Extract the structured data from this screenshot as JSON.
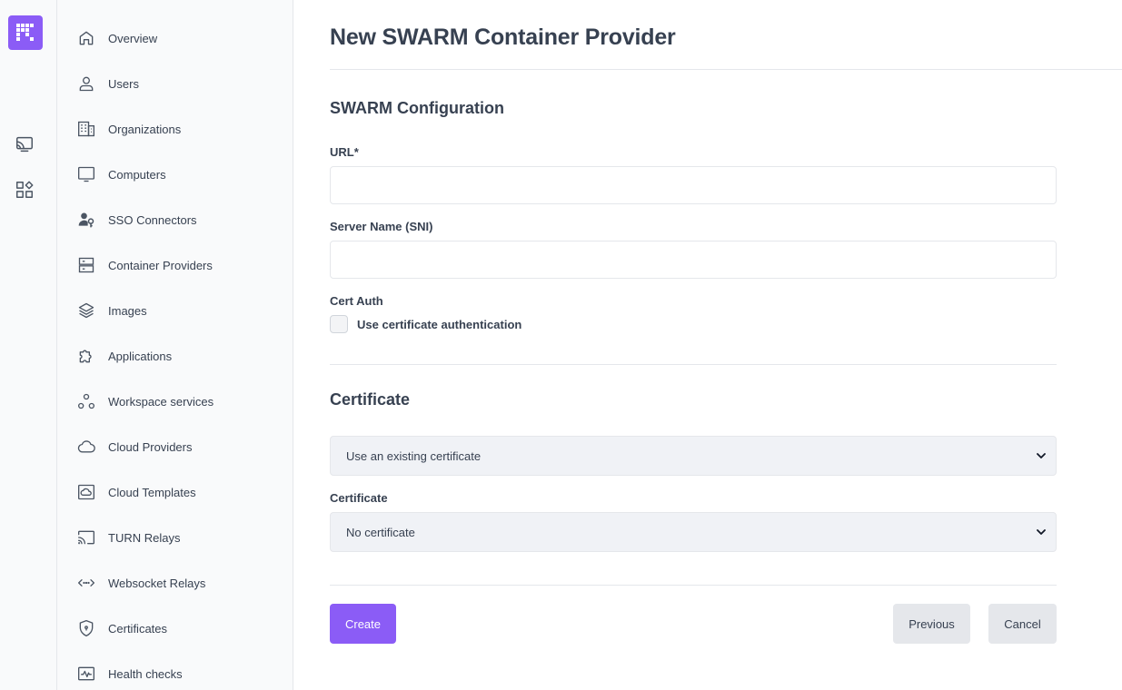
{
  "nav": {
    "items": [
      {
        "label": "Overview",
        "icon": "home-icon"
      },
      {
        "label": "Users",
        "icon": "user-icon"
      },
      {
        "label": "Organizations",
        "icon": "building-icon"
      },
      {
        "label": "Computers",
        "icon": "monitor-icon"
      },
      {
        "label": "SSO Connectors",
        "icon": "user-key-icon"
      },
      {
        "label": "Container Providers",
        "icon": "server-icon"
      },
      {
        "label": "Images",
        "icon": "layers-icon"
      },
      {
        "label": "Applications",
        "icon": "puzzle-icon"
      },
      {
        "label": "Workspace services",
        "icon": "nodes-icon"
      },
      {
        "label": "Cloud Providers",
        "icon": "cloud-icon"
      },
      {
        "label": "Cloud Templates",
        "icon": "cloud-template-icon"
      },
      {
        "label": "TURN Relays",
        "icon": "cast-icon"
      },
      {
        "label": "Websocket Relays",
        "icon": "code-arrows-icon"
      },
      {
        "label": "Certificates",
        "icon": "shield-icon"
      },
      {
        "label": "Health checks",
        "icon": "pulse-icon"
      }
    ]
  },
  "main": {
    "title": "New SWARM Container Provider",
    "config_section": "SWARM Configuration",
    "url_label": "URL*",
    "url_value": "",
    "sni_label": "Server Name (SNI)",
    "sni_value": "",
    "cert_auth_label": "Cert Auth",
    "cert_auth_checkbox_label": "Use certificate authentication",
    "cert_auth_checked": false,
    "certificate_section": "Certificate",
    "cert_mode_value": "Use an existing certificate",
    "certificate_label": "Certificate",
    "certificate_value": "No certificate"
  },
  "buttons": {
    "create": "Create",
    "previous": "Previous",
    "cancel": "Cancel"
  },
  "colors": {
    "accent": "#8b5cf6",
    "text": "#374151",
    "border": "#e5e7eb",
    "sidebar_bg": "#f9fafb",
    "select_bg": "#f0f2f6"
  }
}
